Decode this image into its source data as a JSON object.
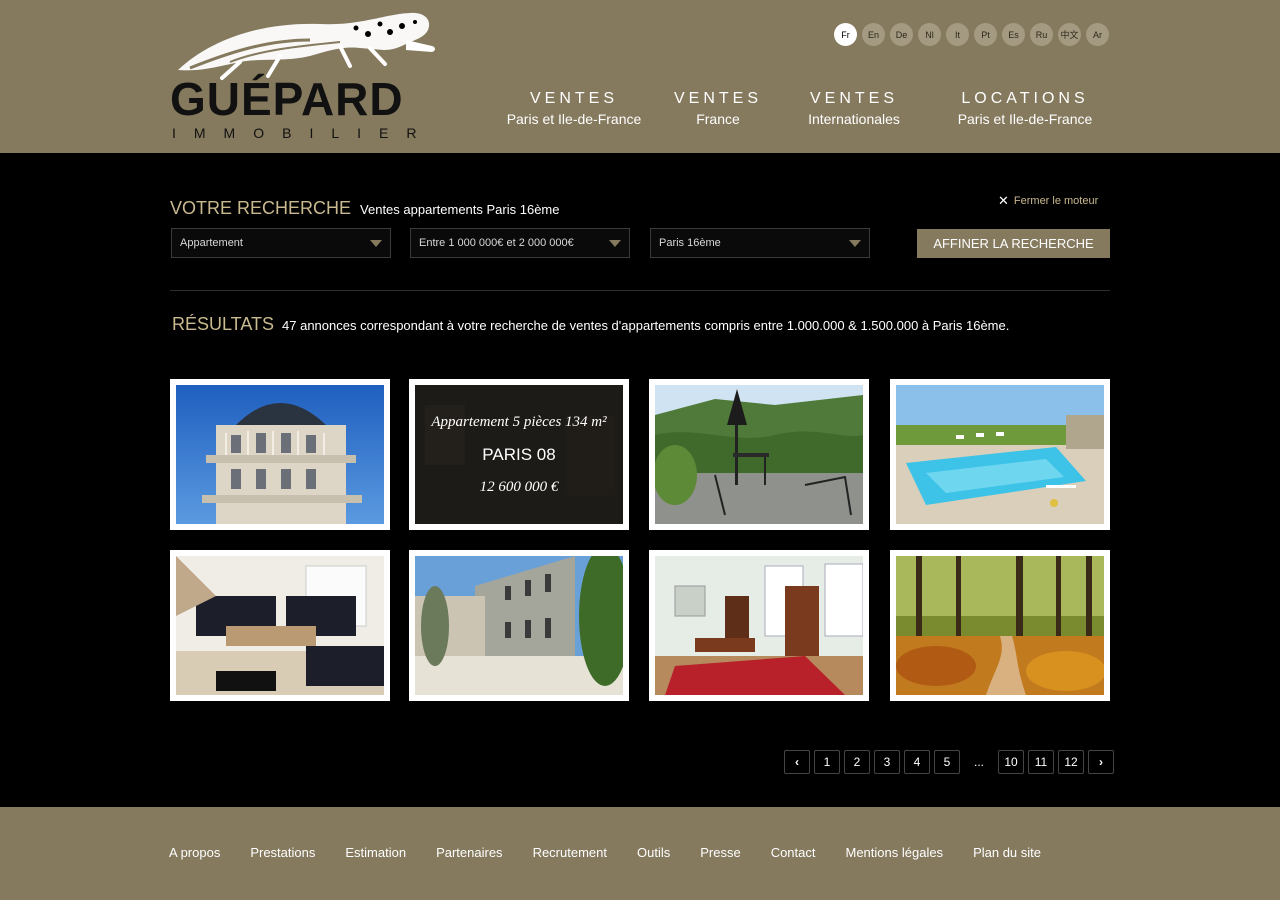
{
  "brand": {
    "name": "GUÉPARD",
    "tagline": "IMMOBILIER",
    "logo_icon": "cheetah-icon"
  },
  "languages": [
    {
      "code": "Fr",
      "active": true
    },
    {
      "code": "En",
      "active": false
    },
    {
      "code": "De",
      "active": false
    },
    {
      "code": "Nl",
      "active": false
    },
    {
      "code": "It",
      "active": false
    },
    {
      "code": "Pt",
      "active": false
    },
    {
      "code": "Es",
      "active": false
    },
    {
      "code": "Ru",
      "active": false
    },
    {
      "code": "中文",
      "active": false
    },
    {
      "code": "Ar",
      "active": false
    }
  ],
  "nav": [
    {
      "main": "VENTES",
      "sub": "Paris et Ile-de-France"
    },
    {
      "main": "VENTES",
      "sub": "France"
    },
    {
      "main": "VENTES",
      "sub": "Internationales"
    },
    {
      "main": "LOCATIONS",
      "sub": "Paris et Ile-de-France"
    }
  ],
  "search": {
    "label": "VOTRE RECHERCHE",
    "value": "Ventes appartements Paris 16ème",
    "close_label": "Fermer le moteur",
    "filters": [
      {
        "value": "Appartement"
      },
      {
        "value": "Entre 1 000 000€ et 2 000 000€"
      },
      {
        "value": "Paris 16ème"
      }
    ],
    "refine_label": "AFFINER LA RECHERCHE"
  },
  "results": {
    "label": "RÉSULTATS",
    "summary": "47 annonces correspondant à votre recherche de ventes d'appartements compris entre 1.000.000 & 1.500.000 à Paris 16ème."
  },
  "listings": [
    {
      "image": "haussmann-building-photo"
    },
    {
      "image": "apartment-photo",
      "overlay": {
        "title": "Appartement 5 pièces 134 m²",
        "location": "PARIS 08",
        "price": "12 600 000 €"
      }
    },
    {
      "image": "terrace-mountain-photo"
    },
    {
      "image": "pool-garden-photo"
    },
    {
      "image": "living-room-photo"
    },
    {
      "image": "stone-courtyard-photo"
    },
    {
      "image": "antique-office-photo"
    },
    {
      "image": "forest-path-photo"
    }
  ],
  "pagination": {
    "prev_icon": "chevron-left-icon",
    "next_icon": "chevron-right-icon",
    "pages": [
      "1",
      "2",
      "3",
      "4",
      "5"
    ],
    "ellipsis": "...",
    "last_pages": [
      "10",
      "11",
      "12"
    ]
  },
  "footer": {
    "links": [
      "A propos",
      "Prestations",
      "Estimation",
      "Partenaires",
      "Recrutement",
      "Outils",
      "Presse",
      "Contact",
      "Mentions légales",
      "Plan du site"
    ]
  },
  "colors": {
    "brand_bg": "#85795e",
    "accent_text": "#c9b98e"
  }
}
